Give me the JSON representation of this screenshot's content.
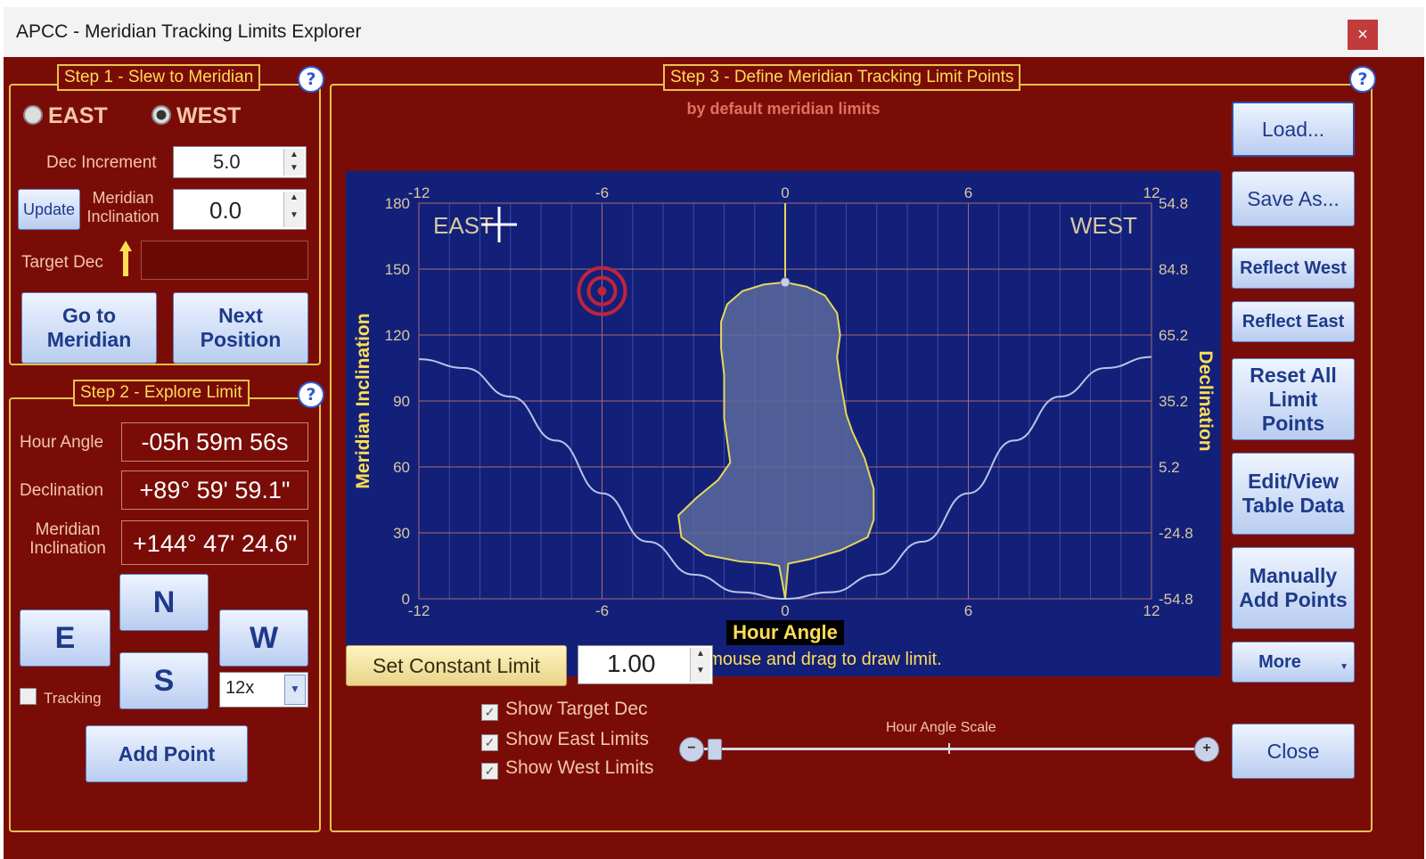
{
  "window": {
    "title": "APCC - Meridian Tracking Limits Explorer",
    "close_glyph": "×"
  },
  "step1": {
    "title": "Step 1 - Slew to Meridian",
    "east_label": "EAST",
    "west_label": "WEST",
    "selected_side": "WEST",
    "dec_increment_label": "Dec Increment",
    "dec_increment_value": "5.0",
    "update_label": "Update",
    "meridian_inclination_label": "Meridian Inclination",
    "meridian_inclination_value": "0.0",
    "target_dec_label": "Target Dec",
    "target_dec_value": "",
    "goto_label": "Go to Meridian",
    "next_label": "Next Position"
  },
  "step2": {
    "title": "Step 2 - Explore Limit",
    "hour_angle_label": "Hour Angle",
    "hour_angle_value": "-05h 59m 56s",
    "declination_label": "Declination",
    "declination_value": "+89° 59' 59.1\"",
    "meridian_inclination_label": "Meridian Inclination",
    "meridian_inclination_value": "+144° 47' 24.6\"",
    "n_label": "N",
    "s_label": "S",
    "e_label": "E",
    "w_label": "W",
    "tracking_label": "Tracking",
    "tracking_checked": false,
    "rate_value": "12x",
    "add_point_label": "Add Point"
  },
  "step3": {
    "title": "Step 3 - Define Meridian Tracking Limit Points",
    "subtitle": "by default meridian limits",
    "plot_east": "EAST",
    "plot_west": "WEST",
    "instruction": "Press left mouse and drag to draw limit.",
    "set_constant_label": "Set Constant Limit",
    "constant_value": "1.00",
    "show_target_dec_label": "Show Target Dec",
    "show_east_limits_label": "Show East Limits",
    "show_west_limits_label": "Show West Limits",
    "show_target_dec": true,
    "show_east_limits": true,
    "show_west_limits": true,
    "hour_angle_scale_label": "Hour Angle Scale"
  },
  "buttons": {
    "load": "Load...",
    "save_as": "Save As...",
    "reflect_west": "Reflect West",
    "reflect_east": "Reflect East",
    "reset_all": "Reset All Limit Points",
    "edit_view": "Edit/View Table Data",
    "manually_add": "Manually Add Points",
    "more": "More",
    "close": "Close"
  },
  "colors": {
    "background": "#7a0c08",
    "border_gold": "#e6c44a",
    "plot_bg": "#13207a",
    "limit_line": "#e6d85a",
    "limit_fill": "#5a6a9c",
    "dec_curve": "#b8c4e8",
    "target": "#c0243a"
  },
  "chart_data": {
    "type": "line",
    "xlabel": "Hour Angle",
    "ylabel": "Meridian Inclination",
    "y2label": "Declination",
    "xlim": [
      -12,
      12
    ],
    "ylim": [
      0,
      180
    ],
    "x_ticks": [
      -12,
      -6,
      0,
      6,
      12
    ],
    "y_ticks": [
      0,
      30,
      60,
      90,
      120,
      150,
      180
    ],
    "y2_ticks": [
      "-54.8",
      "-24.8",
      "5.2",
      "35.2",
      "65.2",
      "84.8",
      "54.8"
    ],
    "grid": true,
    "series": [
      {
        "kind": "limit_polygon",
        "points": [
          [
            0,
            0
          ],
          [
            -0.1,
            8
          ],
          [
            -0.2,
            15
          ],
          [
            -0.6,
            16
          ],
          [
            -1.5,
            17
          ],
          [
            -2.6,
            20
          ],
          [
            -3.4,
            28
          ],
          [
            -3.5,
            38
          ],
          [
            -2.9,
            46
          ],
          [
            -2.2,
            54
          ],
          [
            -1.8,
            62
          ],
          [
            -1.9,
            72
          ],
          [
            -2.0,
            82
          ],
          [
            -2.0,
            92
          ],
          [
            -2.0,
            102
          ],
          [
            -2.1,
            114
          ],
          [
            -2.1,
            126
          ],
          [
            -1.9,
            134
          ],
          [
            -1.4,
            140
          ],
          [
            -0.7,
            143
          ],
          [
            0,
            144
          ],
          [
            0.7,
            142
          ],
          [
            1.3,
            138
          ],
          [
            1.7,
            130
          ],
          [
            1.8,
            120
          ],
          [
            1.7,
            110
          ],
          [
            1.8,
            100
          ],
          [
            1.9,
            92
          ],
          [
            2.0,
            84
          ],
          [
            2.2,
            76
          ],
          [
            2.6,
            64
          ],
          [
            2.9,
            50
          ],
          [
            2.9,
            36
          ],
          [
            2.7,
            28
          ],
          [
            1.8,
            22
          ],
          [
            0.8,
            18
          ],
          [
            0.1,
            16
          ],
          [
            0,
            0
          ]
        ]
      },
      {
        "kind": "declination_curve",
        "points": [
          [
            -12,
            109
          ],
          [
            -10.5,
            105
          ],
          [
            -9,
            92
          ],
          [
            -7.5,
            72
          ],
          [
            -6,
            48
          ],
          [
            -4.5,
            26
          ],
          [
            -3,
            11
          ],
          [
            -1.5,
            3
          ],
          [
            0,
            0
          ],
          [
            1.5,
            3
          ],
          [
            3,
            11
          ],
          [
            4.5,
            26
          ],
          [
            6,
            48
          ],
          [
            7.5,
            72
          ],
          [
            9,
            92
          ],
          [
            10.5,
            105
          ],
          [
            12,
            110
          ]
        ]
      }
    ],
    "meridian_marker": [
      0,
      144
    ],
    "target_marker": [
      -6,
      140
    ]
  }
}
